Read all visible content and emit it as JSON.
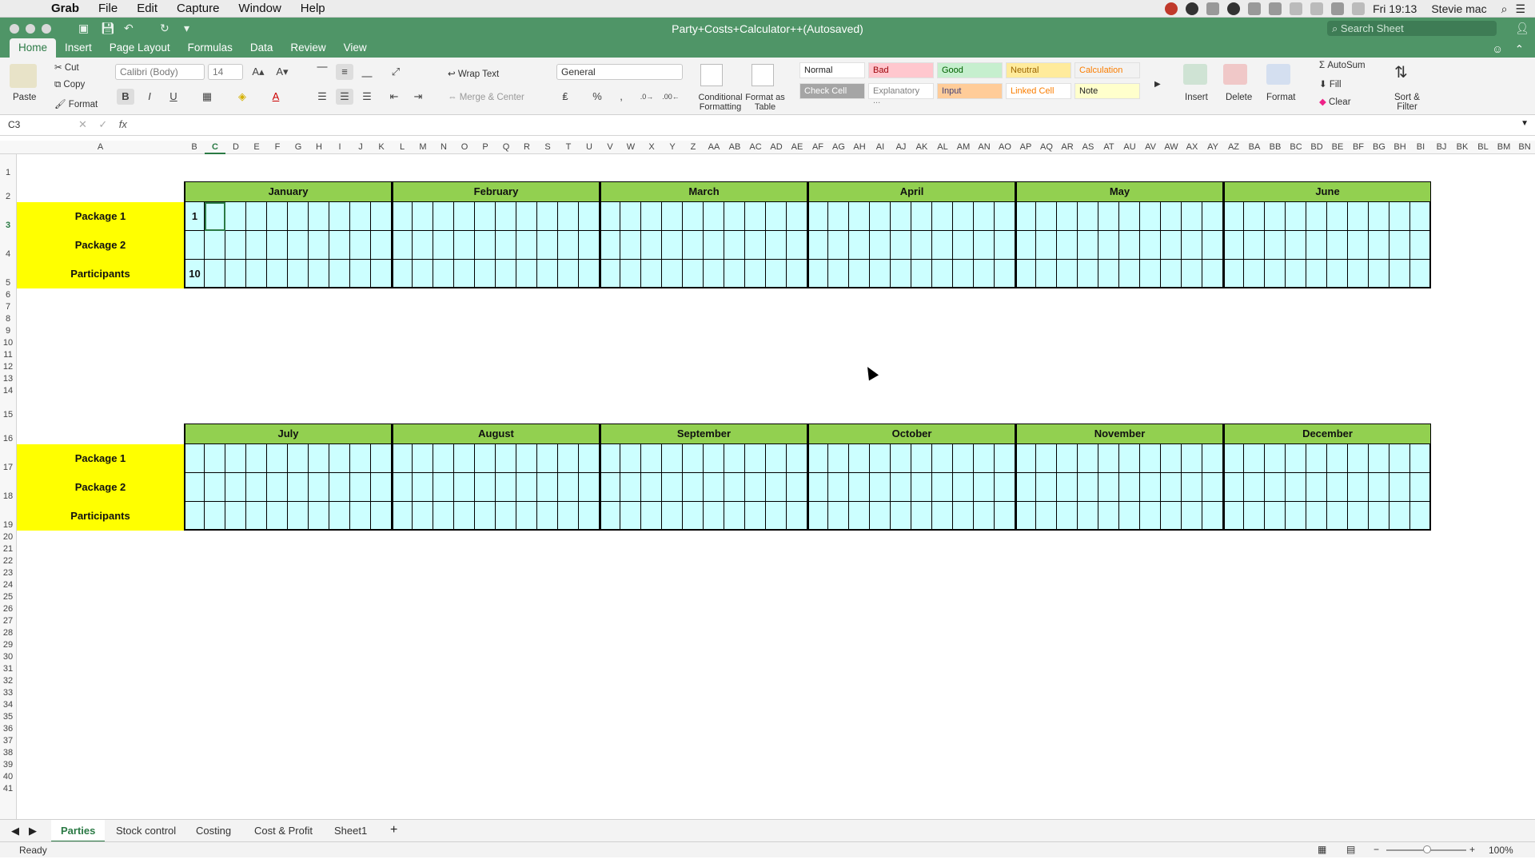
{
  "menubar": {
    "app": "Grab",
    "items": [
      "File",
      "Edit",
      "Capture",
      "Window",
      "Help"
    ],
    "clock": "Fri 19:13",
    "user": "Stevie mac"
  },
  "window": {
    "title": "Party+Costs+Calculator++(Autosaved)",
    "search_placeholder": "Search Sheet"
  },
  "ribbon_tabs": [
    "Home",
    "Insert",
    "Page Layout",
    "Formulas",
    "Data",
    "Review",
    "View"
  ],
  "active_tab": "Home",
  "ribbon": {
    "paste": "Paste",
    "cut": "Cut",
    "copy": "Copy",
    "format_painter": "Format",
    "font": "Calibri (Body)",
    "font_size": "14",
    "bold": "B",
    "italic": "I",
    "underline": "U",
    "wrap_text": "Wrap Text",
    "merge_center": "Merge & Center",
    "number_format": "General",
    "conditional_formatting": "Conditional Formatting",
    "format_as_table": "Format as Table",
    "styles": [
      {
        "name": "Normal",
        "bg": "#ffffff",
        "fg": "#222222"
      },
      {
        "name": "Bad",
        "bg": "#ffc7ce",
        "fg": "#9c0006"
      },
      {
        "name": "Good",
        "bg": "#c6efce",
        "fg": "#006100"
      },
      {
        "name": "Neutral",
        "bg": "#ffeb9c",
        "fg": "#9c6500"
      },
      {
        "name": "Calculation",
        "bg": "#f2f2f2",
        "fg": "#fa7d00"
      },
      {
        "name": "Check Cell",
        "bg": "#a5a5a5",
        "fg": "#ffffff"
      },
      {
        "name": "Explanatory ...",
        "bg": "#ffffff",
        "fg": "#7f7f7f"
      },
      {
        "name": "Input",
        "bg": "#ffcc99",
        "fg": "#3f3f76"
      },
      {
        "name": "Linked Cell",
        "bg": "#ffffff",
        "fg": "#fa7d00"
      },
      {
        "name": "Note",
        "bg": "#ffffcc",
        "fg": "#222222"
      }
    ],
    "insert": "Insert",
    "delete": "Delete",
    "format": "Format",
    "autosum": "AutoSum",
    "fill": "Fill",
    "clear": "Clear",
    "sort_filter": "Sort & Filter"
  },
  "formula_bar": {
    "name_box": "C3",
    "fx": "fx",
    "content": ""
  },
  "column_headers": [
    "A",
    "B",
    "C",
    "D",
    "E",
    "F",
    "G",
    "H",
    "I",
    "J",
    "K",
    "L",
    "M",
    "N",
    "O",
    "P",
    "Q",
    "R",
    "S",
    "T",
    "U",
    "V",
    "W",
    "X",
    "Y",
    "Z",
    "AA",
    "AB",
    "AC",
    "AD",
    "AE",
    "AF",
    "AG",
    "AH",
    "AI",
    "AJ",
    "AK",
    "AL",
    "AM",
    "AN",
    "AO",
    "AP",
    "AQ",
    "AR",
    "AS",
    "AT",
    "AU",
    "AV",
    "AW",
    "AX",
    "AY",
    "AZ",
    "BA",
    "BB",
    "BC",
    "BD",
    "BE",
    "BF",
    "BG",
    "BH",
    "BI",
    "BJ",
    "BK",
    "BL",
    "BM",
    "BN"
  ],
  "row_headers": [
    "1",
    "2",
    "3",
    "4",
    "5",
    "6",
    "7",
    "8",
    "9",
    "10",
    "11",
    "12",
    "13",
    "14",
    "15",
    "16",
    "17",
    "18",
    "19",
    "20",
    "21",
    "22",
    "23",
    "24",
    "25",
    "26",
    "27",
    "28",
    "29",
    "30",
    "31",
    "32",
    "33",
    "34",
    "35",
    "36",
    "37",
    "38",
    "39",
    "40",
    "41"
  ],
  "table1": {
    "months": [
      "January",
      "February",
      "March",
      "April",
      "May",
      "June"
    ],
    "rows": [
      "Package 1",
      "Package 2",
      "Participants"
    ],
    "values": {
      "Package 1": "1",
      "Participants": "10"
    }
  },
  "table2": {
    "months": [
      "July",
      "August",
      "September",
      "October",
      "November",
      "December"
    ],
    "rows": [
      "Package 1",
      "Package 2",
      "Participants"
    ]
  },
  "sheet_tabs": [
    "Parties",
    "Stock control",
    "Costing",
    "Cost & Profit",
    "Sheet1"
  ],
  "active_sheet": "Parties",
  "status": {
    "mode": "Ready",
    "zoom": "100%"
  },
  "colors": {
    "header_green": "#92d050",
    "label_yellow": "#ffff00",
    "cell_cyan": "#ccffff",
    "excel_green": "#4f9567"
  }
}
